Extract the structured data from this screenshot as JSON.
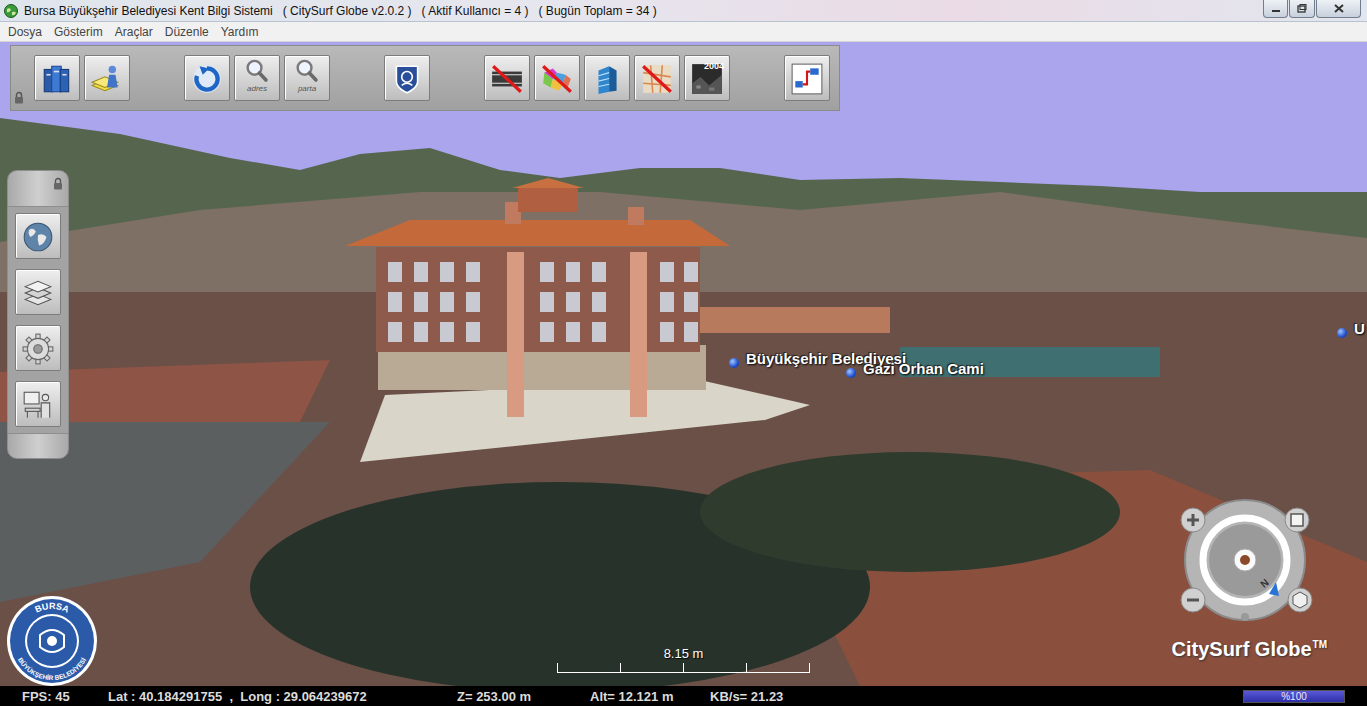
{
  "window": {
    "title": "Bursa Büyükşehir Belediyesi Kent Bilgi Sistemi   ( CitySurf Globe v2.0.2 )   ( Aktif Kullanıcı = 4 )   ( Bugün Toplam = 34 )"
  },
  "menu": [
    "Dosya",
    "Gösterim",
    "Araçlar",
    "Düzenle",
    "Yardım"
  ],
  "toolbar": {
    "locked": true,
    "groups": [
      [
        {
          "kind": "books"
        },
        {
          "kind": "user"
        }
      ],
      [
        {
          "kind": "refresh"
        },
        {
          "kind": "search",
          "caption": "adres"
        },
        {
          "kind": "search",
          "caption": "parta"
        }
      ],
      [
        {
          "kind": "emblem"
        }
      ],
      [
        {
          "kind": "road-off"
        },
        {
          "kind": "map-off"
        },
        {
          "kind": "building"
        },
        {
          "kind": "grid-off"
        },
        {
          "kind": "photo",
          "caption": "2004"
        }
      ],
      [
        {
          "kind": "route"
        }
      ]
    ]
  },
  "side_toolbar": {
    "locked": true,
    "buttons": [
      {
        "kind": "globe"
      },
      {
        "kind": "layers"
      },
      {
        "kind": "gear"
      },
      {
        "kind": "presenter"
      }
    ]
  },
  "map_labels": [
    {
      "label": "Büyükşehir Belediyesi"
    },
    {
      "label": "Gazi Orhan Cami"
    },
    {
      "label": "U"
    }
  ],
  "scale_bar": {
    "label": "8.15 m"
  },
  "compass": {
    "north": "N"
  },
  "brand": {
    "name": "CitySurf Globe",
    "mark": "TM"
  },
  "logo": {
    "top": "BURSA",
    "bottom": "BÜYÜKŞEHİR BELEDİYESİ"
  },
  "status_bar": {
    "fps": "FPS: 45",
    "position": "Lat : 40.184291755  ,  Long : 29.064239672",
    "z": "Z= 253.00 m",
    "alt": "Alt= 12.121 m",
    "rate": "KB/s= 21.23",
    "progress": {
      "label": "%100",
      "level": 1
    }
  }
}
